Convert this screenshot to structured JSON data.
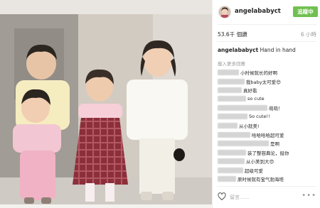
{
  "post": {
    "username": "angelababyct",
    "follow_label": "追蹤中",
    "likes": "53.6千 個讚",
    "time": "6 小時",
    "caption_user": "angelababyct",
    "caption_text": " Hand in hand",
    "load_more": "載入更多回應",
    "leave_comment_placeholder": "留言......",
    "accent_color": "#70c050"
  },
  "comments": [
    {
      "text": "小时候就长的好啊"
    },
    {
      "text": "我baby太可爱😍"
    },
    {
      "text": "真好看"
    },
    {
      "text": "so cute"
    },
    {
      "text": "萌萌！"
    },
    {
      "text": "So cute!!"
    },
    {
      "text": "从小就美!"
    },
    {
      "text": "哈哈哈哈超可爱"
    },
    {
      "text": "是啊"
    },
    {
      "text": "装了整容典论，挺你"
    },
    {
      "text": "从小美到大😍"
    },
    {
      "text": "超级可爱"
    },
    {
      "text": "原时候就有宝气勃海塔"
    }
  ],
  "icons": {
    "heart": "heart-outline-icon",
    "more": "more-dots-icon"
  }
}
